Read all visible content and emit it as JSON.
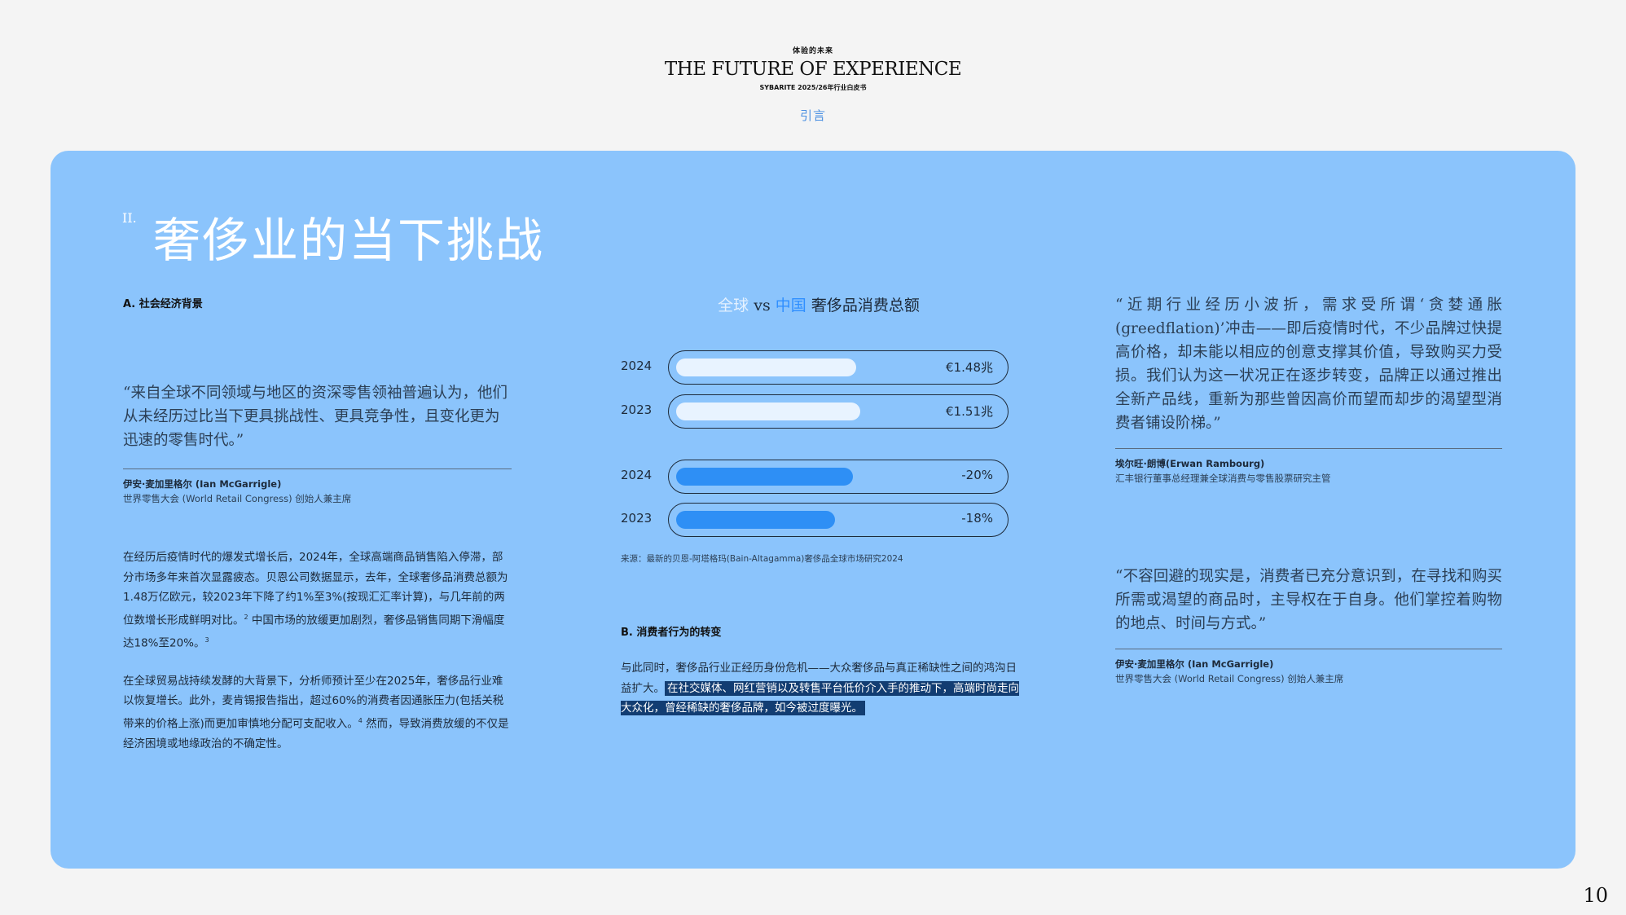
{
  "header": {
    "kicker": "体验的未来",
    "title": "THE FUTURE OF EXPERIENCE",
    "subtitle": "SYBARITE 2025/26年行业白皮书",
    "section": "引言"
  },
  "heading": {
    "number": "II.",
    "title": "奢侈业的当下挑战"
  },
  "left": {
    "section_head": "A. 社会经济背景",
    "quote": "“来自全球不同领域与地区的资深零售领袖普遍认为，他们从未经历过比当下更具挑战性、更具竞争性，且变化更为迅速的零售时代。”",
    "attribution_name": "伊安·麦加里格尔 (Ian McGarrigle)",
    "attribution_role": "世界零售大会 (World Retail Congress) 创始人兼主席",
    "para1_a": "在经历后疫情时代的爆发式增长后，2024年，全球高端商品销售陷入停滞，部分市场多年来首次显露疲态。贝恩公司数据显示，去年，全球奢侈品消费总额为1.48万亿欧元，较2023年下降了约1%至3%(按现汇汇率计算)，与几年前的两位数增长形成鲜明对比。",
    "para1_sup1": "2",
    "para1_b": " 中国市场的放缓更加剧烈，奢侈品销售同期下滑幅度达18%至20%。",
    "para1_sup2": "3",
    "para2_a": "在全球贸易战持续发酵的大背景下，分析师预计至少在2025年，奢侈品行业难以恢复增长。此外，麦肯锡报告指出，超过60%的消费者因通胀压力(包括关税带来的价格上涨)而更加审慎地分配可支配收入。",
    "para2_sup": "4",
    "para2_b": " 然而，导致消费放缓的不仅是经济困境或地缘政治的不确定性。"
  },
  "chart_data": {
    "type": "bar",
    "title_parts": {
      "global": "全球",
      "vs": "vs",
      "china": "中国",
      "rest": "奢侈品消费总额"
    },
    "series": [
      {
        "name": "全球",
        "color": "#e8f3ff",
        "categories": [
          "2024",
          "2023"
        ],
        "values": [
          1.48,
          1.51
        ],
        "labels": [
          "€1.48兆",
          "€1.51兆"
        ]
      },
      {
        "name": "中国",
        "color": "#2e8ff5",
        "categories": [
          "2024",
          "2023"
        ],
        "values": [
          -20,
          -18
        ],
        "labels": [
          "-20%",
          "-18%"
        ]
      }
    ],
    "source": "来源：最新的贝恩-阿塔格玛(Bain-Altagamma)奢侈品全球市场研究2024"
  },
  "center": {
    "section_head": "B. 消费者行为的转变",
    "para_a": "与此同时，奢侈品行业正经历身份危机——大众奢侈品与真正稀缺性之间的鸿沟日益扩大。",
    "para_highlight": "在社交媒体、网红营销以及转售平台低价介入手的推动下，高端时尚走向大众化，曾经稀缺的奢侈品牌，如今被过度曝光。"
  },
  "right": {
    "quote1": "“近期行业经历小波折，需求受所谓‘贪婪通胀(greedflation)’冲击——即后疫情时代，不少品牌过快提高价格，却未能以相应的创意支撑其价值，导致购买力受损。我们认为这一状况正在逐步转变，品牌正以通过推出全新产品线，重新为那些曾因高价而望而却步的渴望型消费者铺设阶梯。”",
    "attribution1_name": "埃尔旺·朗博(Erwan Rambourg)",
    "attribution1_role": "汇丰银行董事总经理兼全球消费与零售股票研究主管",
    "quote2": "“不容回避的现实是，消费者已充分意识到，在寻找和购买所需或渴望的商品时，主导权在于自身。他们掌控着购物的地点、时间与方式。”",
    "attribution2_name": "伊安·麦加里格尔 (Ian McGarrigle)",
    "attribution2_role": "世界零售大会 (World Retail Congress) 创始人兼主席"
  },
  "page_number": "10"
}
